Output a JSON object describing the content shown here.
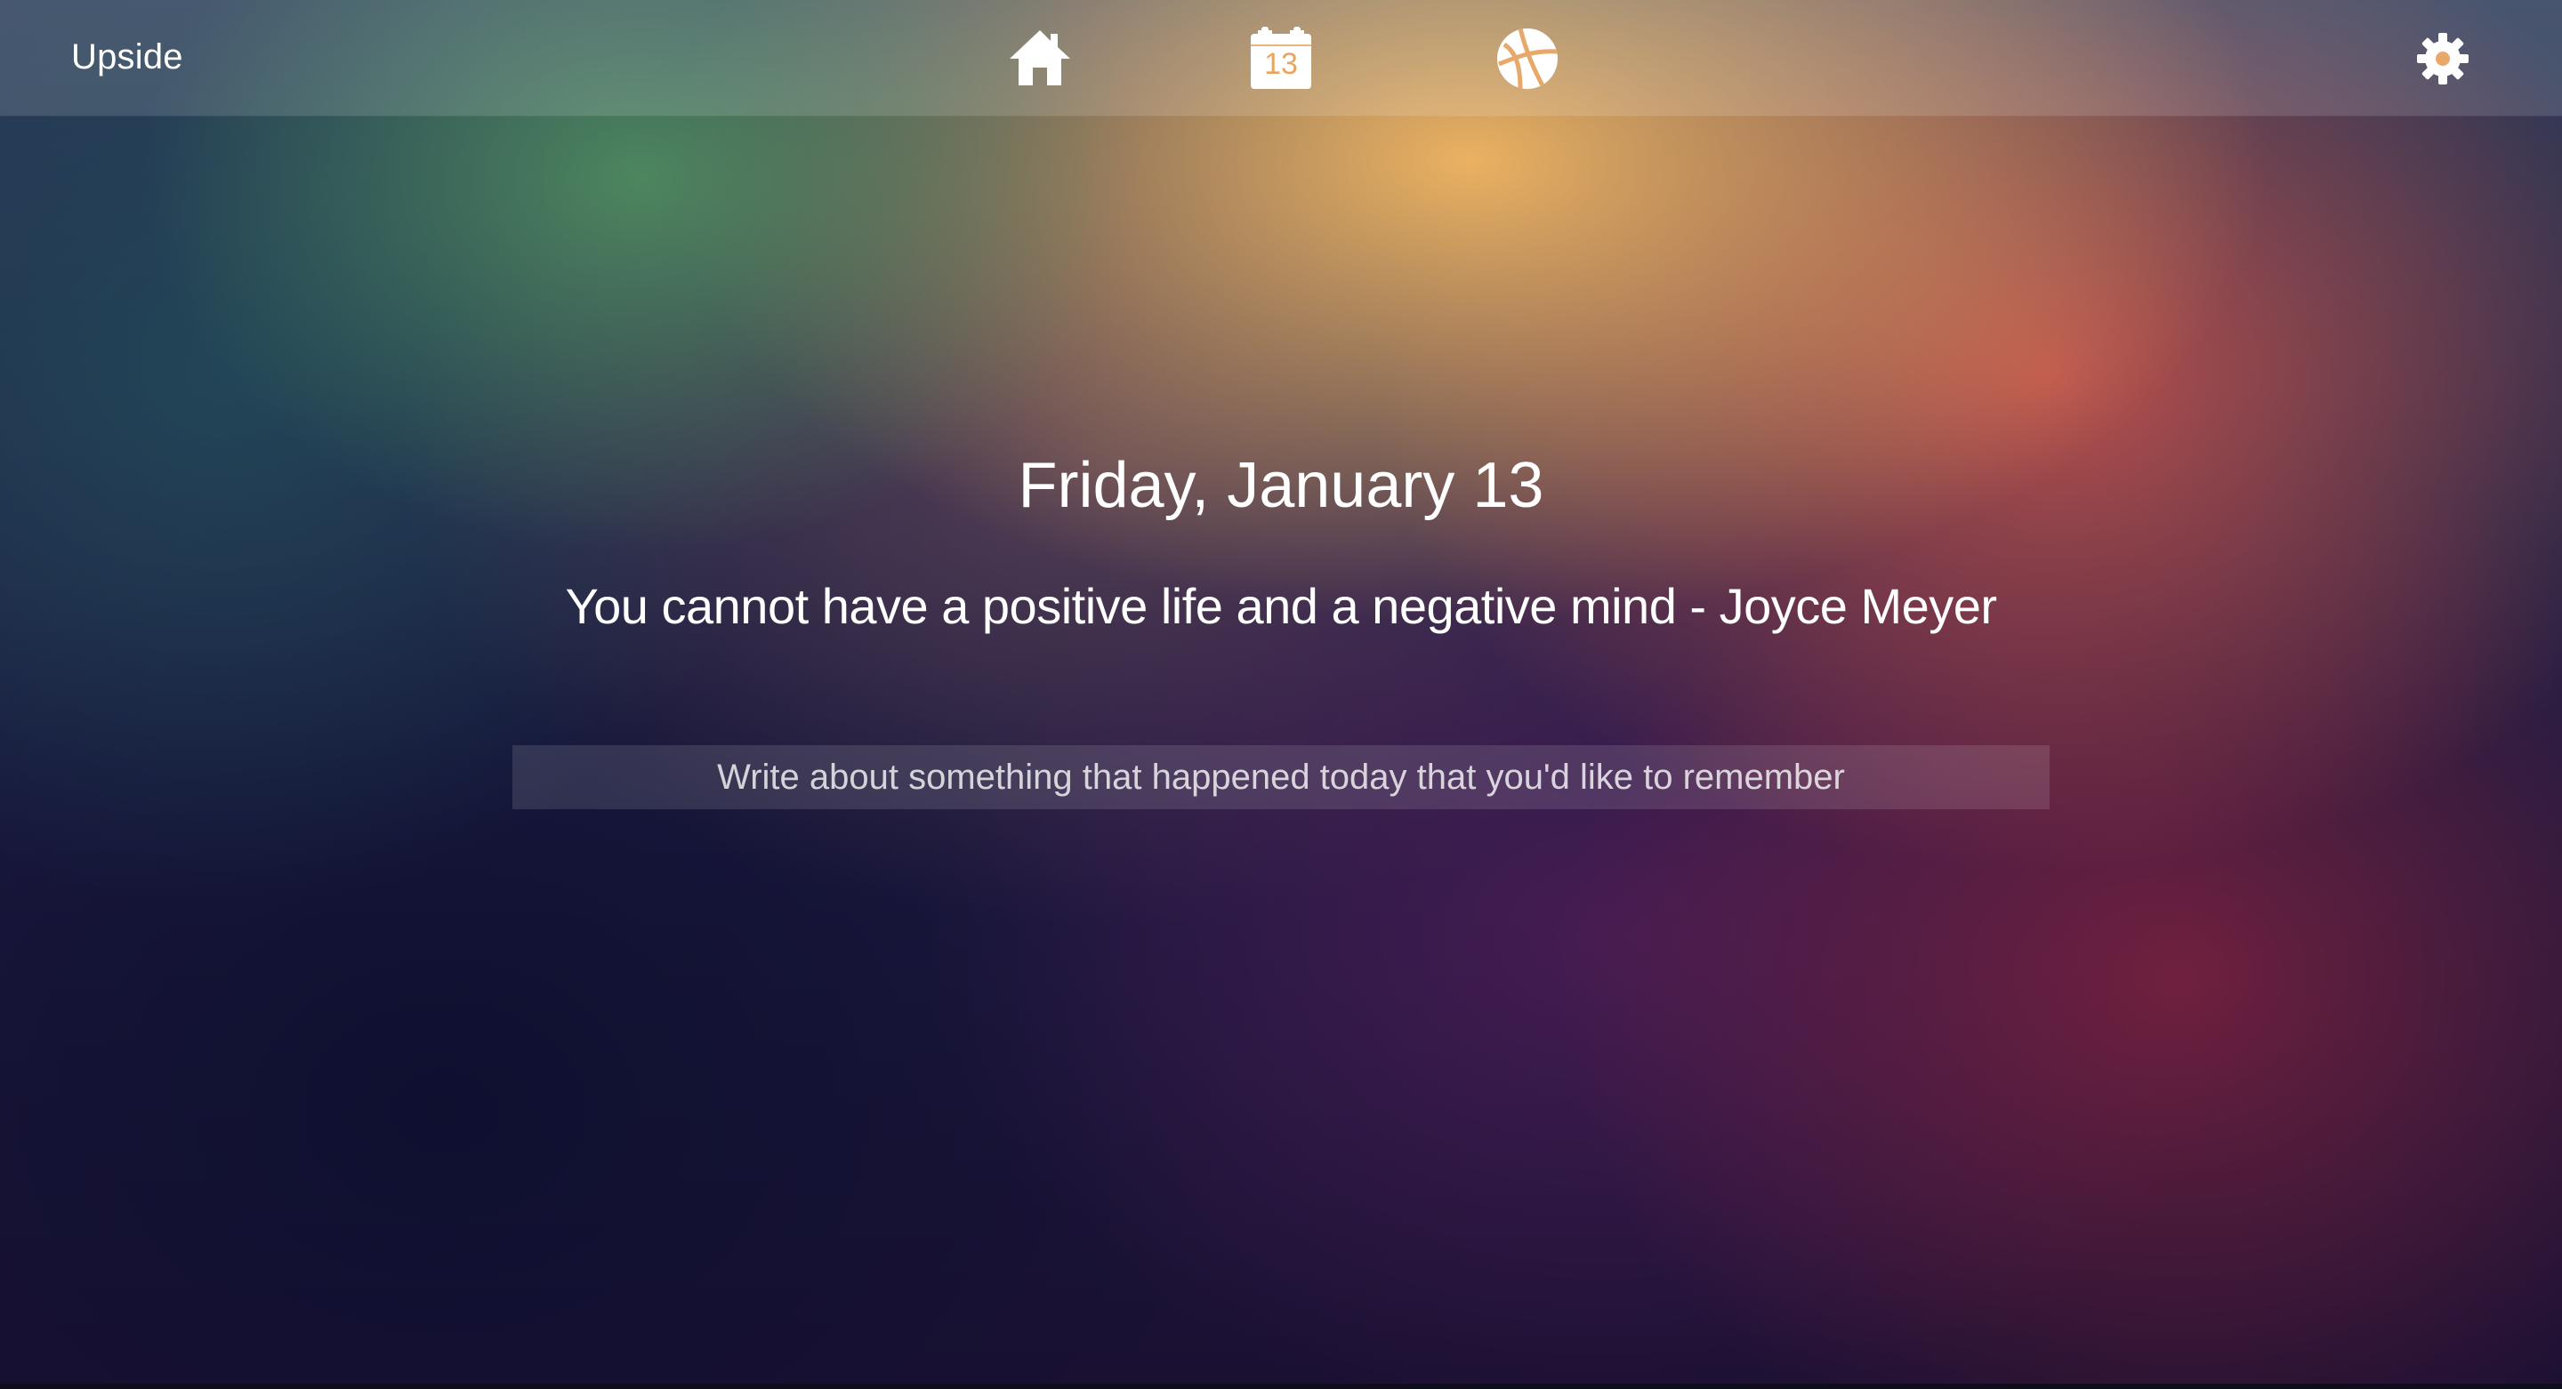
{
  "app": {
    "title": "Upside"
  },
  "nav": {
    "items": [
      {
        "icon": "home-icon",
        "label": ""
      },
      {
        "icon": "calendar-icon",
        "day": "13"
      },
      {
        "icon": "globe-icon",
        "label": ""
      }
    ],
    "settings_icon": "gear-icon"
  },
  "main": {
    "date": "Friday, January 13",
    "quote": "You cannot have a positive life and a negative mind - Joyce Meyer",
    "entry": {
      "value": "",
      "placeholder": "Write about something that happened today that you'd like to remember"
    }
  },
  "colors": {
    "text": "#ffffff",
    "bar_overlay": "rgba(255,255,255,0.14)"
  }
}
